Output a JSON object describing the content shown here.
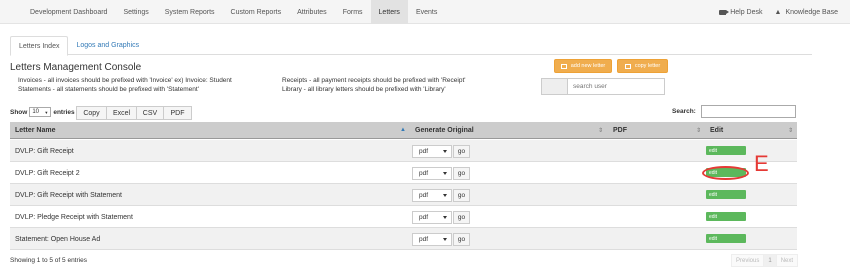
{
  "nav": {
    "items": [
      {
        "label": "Development Dashboard",
        "active": false
      },
      {
        "label": "Settings",
        "active": false
      },
      {
        "label": "System Reports",
        "active": false
      },
      {
        "label": "Custom Reports",
        "active": false
      },
      {
        "label": "Attributes",
        "active": false
      },
      {
        "label": "Forms",
        "active": false
      },
      {
        "label": "Letters",
        "active": true
      },
      {
        "label": "Events",
        "active": false
      }
    ],
    "help_desk": "Help Desk",
    "knowledge_base": "Knowledge Base"
  },
  "tabs": [
    {
      "label": "Letters Index",
      "active": true
    },
    {
      "label": "Logos and Graphics",
      "active": false
    }
  ],
  "console": {
    "title": "Letters Management Console",
    "note_invoices": "Invoices - all invoices should be prefixed with 'Invoice' ex) Invoice: Student",
    "note_statements": "Statements - all statements should be prefixed with 'Statement'",
    "note_receipts": "Receipts - all payment receipts should be prefixed with 'Receipt'",
    "note_library": "Library - all library letters should be prefixed with 'Library'",
    "add_new_letter": "add new letter",
    "copy_letter": "copy letter",
    "search_user_placeholder": "search user"
  },
  "table_controls": {
    "show_label": "Show",
    "length_value": "10",
    "entries_label": "entries",
    "buttons": [
      "Copy",
      "Excel",
      "CSV",
      "PDF"
    ],
    "search_label": "Search:"
  },
  "table": {
    "headers": [
      "Letter Name",
      "Generate Original",
      "PDF",
      "Edit"
    ],
    "rows": [
      {
        "name": "DVLP: Gift Receipt",
        "format": "pdf",
        "go": "go",
        "edit": "edit"
      },
      {
        "name": "DVLP: Gift Receipt 2",
        "format": "pdf",
        "go": "go",
        "edit": "edit"
      },
      {
        "name": "DVLP: Gift Receipt with Statement",
        "format": "pdf",
        "go": "go",
        "edit": "edit"
      },
      {
        "name": "DVLP: Pledge Receipt with Statement",
        "format": "pdf",
        "go": "go",
        "edit": "edit"
      },
      {
        "name": "Statement: Open House Ad",
        "format": "pdf",
        "go": "go",
        "edit": "edit"
      }
    ]
  },
  "annotation": {
    "letter": "E",
    "color": "#e53935"
  },
  "footer": {
    "info": "Showing 1 to 5 of 5 entries",
    "pager": [
      "Previous",
      "1",
      "Next"
    ]
  },
  "colors": {
    "orange": "#f0ad4e",
    "green": "#5cb85c",
    "link": "#337ab7"
  }
}
